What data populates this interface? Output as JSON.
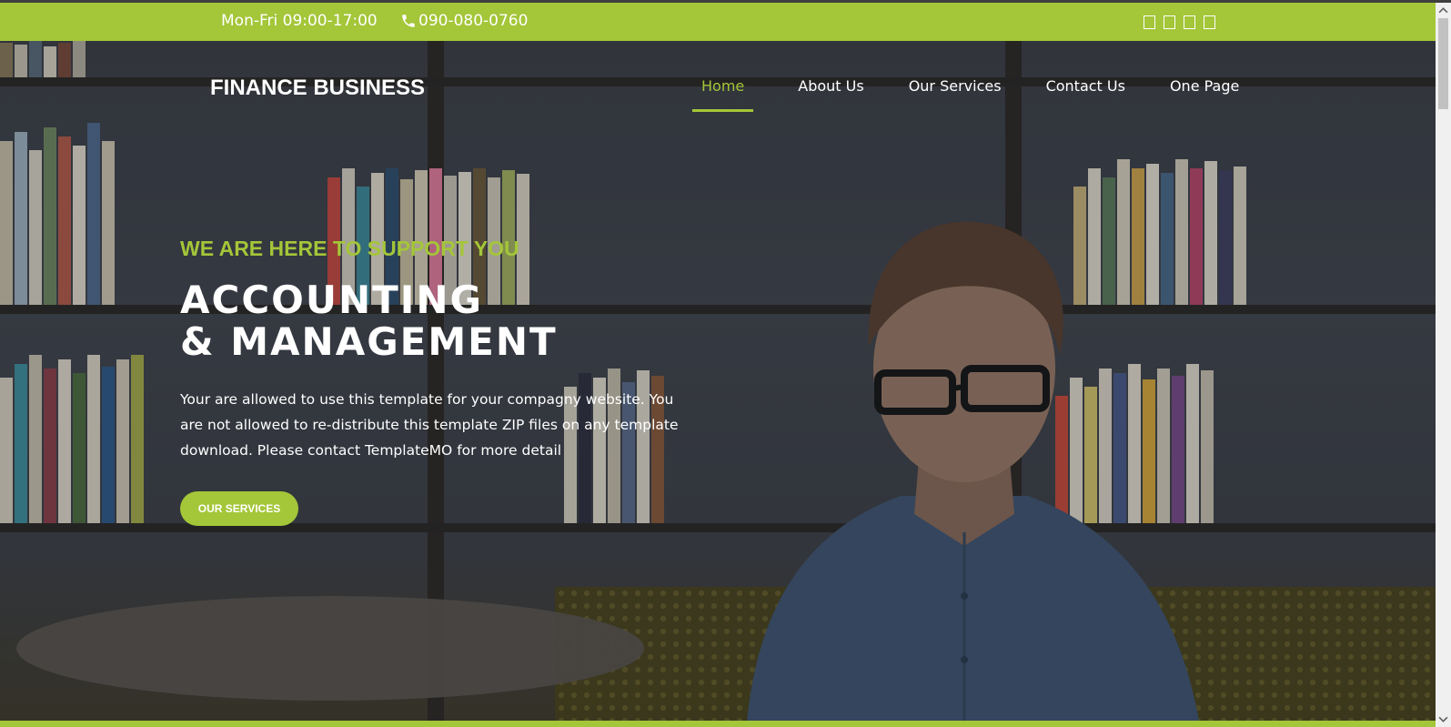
{
  "topbar": {
    "hours": "Mon-Fri 09:00-17:00",
    "phone": "090-080-0760",
    "socials": [
      "facebook-icon",
      "twitter-icon",
      "linkedin-icon",
      "instagram-icon"
    ]
  },
  "header": {
    "logo": "FINANCE BUSINESS",
    "nav": [
      "Home",
      "About Us",
      "Our Services",
      "Contact Us",
      "One Page"
    ],
    "active": "Home"
  },
  "hero": {
    "kicker": "WE ARE HERE TO SUPPORT YOU",
    "headline_line1": "ACCOUNTING",
    "headline_line2": "& MANAGEMENT",
    "description": "Your are allowed to use this template for your compagny website. You are not allowed to re-distribute this template ZIP files on any template download. Please contact TemplateMO for more detail",
    "cta": "OUR SERVICES"
  },
  "colors": {
    "accent": "#a4c639",
    "text": "#ffffff"
  }
}
